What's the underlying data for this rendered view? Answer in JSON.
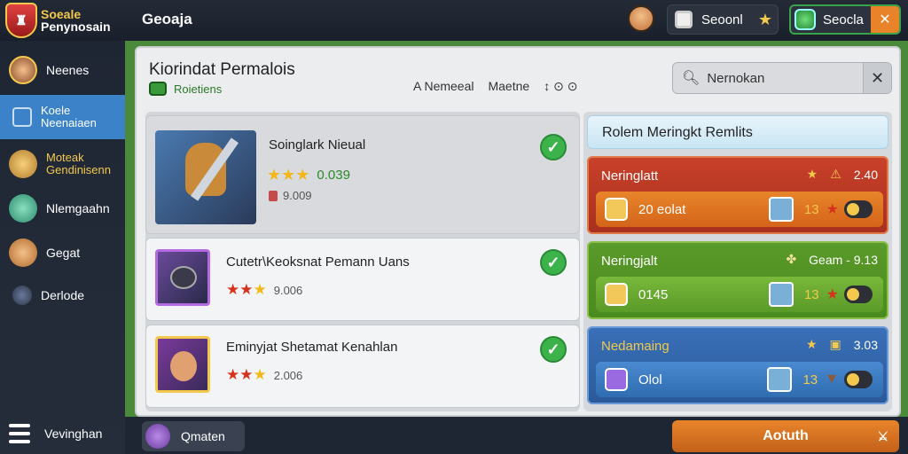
{
  "header": {
    "logo_line1": "Soeale",
    "logo_line2": "Penynosain",
    "app_title": "Geoaja",
    "currency1_value": "Seoonl",
    "currency2_value": "Seocla"
  },
  "sidebar": {
    "items": [
      {
        "label": "Neenes"
      },
      {
        "label": "Koele Neenaiaen"
      },
      {
        "label": "Moteak Gendinisenn"
      },
      {
        "label": "Nlemgaahn"
      },
      {
        "label": "Gegat"
      },
      {
        "label": "Derlode"
      }
    ],
    "bottom_label": "Vevinghan"
  },
  "panel": {
    "title": "Kiorindat Permalois",
    "subtitle": "Roietiens",
    "filters": [
      "A Nemeeal",
      "Maetne",
      "↕ ⊙ ⊙"
    ],
    "search_placeholder": "Nernokan"
  },
  "cards": [
    {
      "name": "Soinglark Nieual",
      "stars": 3,
      "score": "0.039"
    },
    {
      "name": "Cutetr\\Keoksnat Pemann Uans",
      "stars": 3,
      "score": "9.006"
    },
    {
      "name": "Eminyjat Shetamat Kenahlan",
      "stars": 3,
      "score": "2.006"
    }
  ],
  "tiers_header": "Rolem Meringkt Remlits",
  "tiers": [
    {
      "name": "Neringlatt",
      "meta_value": "2.40",
      "item_label": "20 eolat",
      "count": "13",
      "color": "#d65a2a"
    },
    {
      "name": "Neringjalt",
      "meta_value": "Geam - 9.13",
      "item_label": "0145",
      "count": "13",
      "color": "#5a9a2a"
    },
    {
      "name": "Nedamaing",
      "meta_value": "3.03",
      "item_label": "Olol",
      "count": "13",
      "color": "#3a6fb8"
    }
  ],
  "footer": {
    "ext_label": "Qmaten",
    "action_label": "Aotuth"
  }
}
